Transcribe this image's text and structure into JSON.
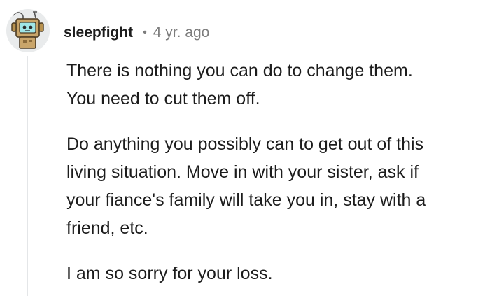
{
  "comment": {
    "username": "sleepfight",
    "separator": "•",
    "timestamp": "4 yr. ago",
    "avatar_icon": "robot-avatar-icon",
    "paragraphs": [
      [
        "There is nothing you can do to change them.",
        "You need to cut them off."
      ],
      [
        "Do anything you possibly can to get out of this",
        "living situation. Move in with your sister, ask if",
        "your fiance's family will take you in, stay with a",
        "friend, etc."
      ],
      [
        "I am so sorry for your loss."
      ]
    ]
  },
  "colors": {
    "text": "#1c1c1c",
    "meta": "#7c7c7c",
    "thread_line": "#e4e6e8",
    "avatar_bg": "#e9ebec",
    "avatar_body": "#c9a56a"
  }
}
